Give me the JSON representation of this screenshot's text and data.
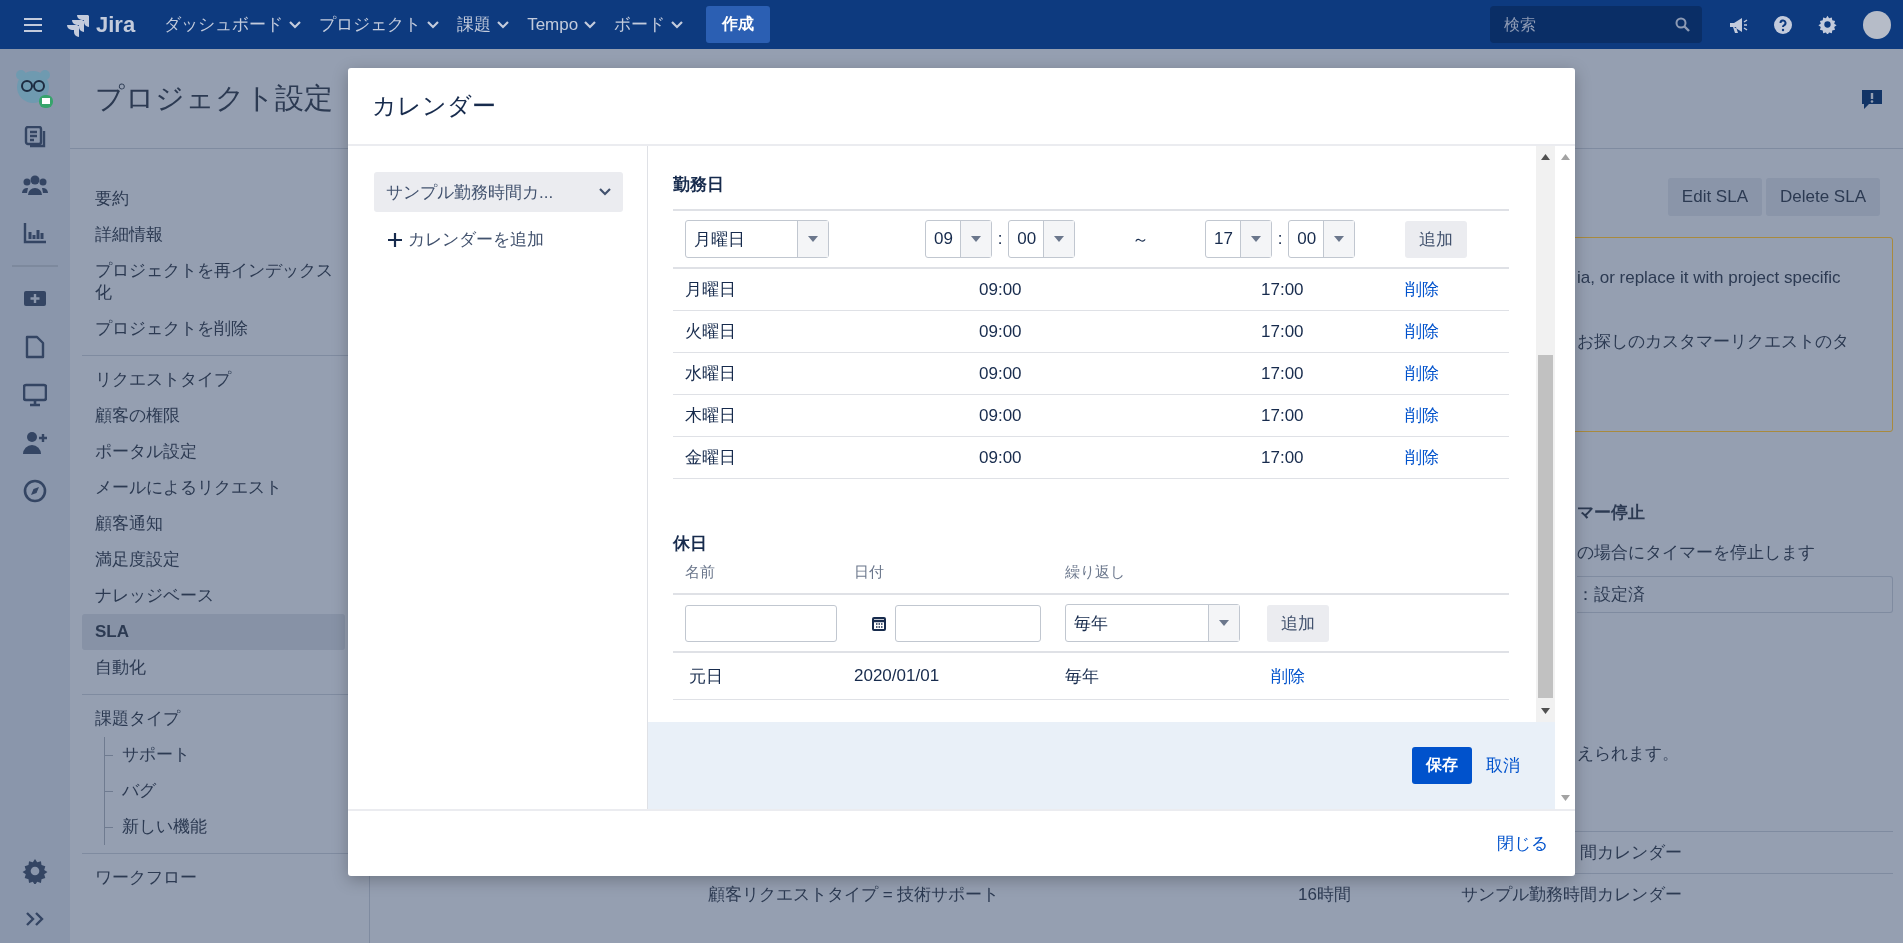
{
  "topbar": {
    "logo_text": "Jira",
    "nav": [
      {
        "label": "ダッシュボード",
        "dropdown": true
      },
      {
        "label": "プロジェクト",
        "dropdown": true
      },
      {
        "label": "課題",
        "dropdown": true
      },
      {
        "label": "Tempo",
        "dropdown": true
      },
      {
        "label": "ボード",
        "dropdown": true
      }
    ],
    "create_button": "作成",
    "search": {
      "placeholder": "検索"
    }
  },
  "page": {
    "title": "プロジェクト設定"
  },
  "sidebar": {
    "groups": [
      {
        "items": [
          {
            "label": "要約",
            "selected": false
          },
          {
            "label": "詳細情報",
            "selected": false
          },
          {
            "label": "プロジェクトを再インデックス化",
            "selected": false
          },
          {
            "label": "プロジェクトを削除",
            "selected": false
          }
        ]
      },
      {
        "items": [
          {
            "label": "リクエストタイプ",
            "selected": false
          },
          {
            "label": "顧客の権限",
            "selected": false
          },
          {
            "label": "ポータル設定",
            "selected": false
          },
          {
            "label": "メールによるリクエスト",
            "selected": false
          },
          {
            "label": "顧客通知",
            "selected": false
          },
          {
            "label": "満足度設定",
            "selected": false
          },
          {
            "label": "ナレッジベース",
            "selected": false
          },
          {
            "label": "SLA",
            "selected": true
          },
          {
            "label": "自動化",
            "selected": false
          }
        ]
      },
      {
        "items": [
          {
            "label": "課題タイプ",
            "selected": false,
            "children": [
              {
                "label": "サポート",
                "selected": false
              },
              {
                "label": "バグ",
                "selected": false
              },
              {
                "label": "新しい機能",
                "selected": false
              }
            ]
          }
        ]
      },
      {
        "items": [
          {
            "label": "ワークフロー",
            "selected": false
          }
        ]
      }
    ]
  },
  "main": {
    "buttons": [
      "Edit SLA",
      "Delete SLA"
    ],
    "notice": {
      "lines": [
        "ia, or replace it with project specific",
        "お探しのカスタマーリクエストのタ"
      ]
    },
    "timer_heading": "マー停止",
    "timer_text": "の場合にタイマーを停止します",
    "condition_field": "：設定済",
    "note": "えられます。",
    "table": {
      "rows": [
        {
          "column_3": "間カレンダー"
        },
        {
          "column_1": "顧客リクエストタイプ = 技術サポート",
          "column_2": "16時間",
          "column_3": "サンプル勤務時間カレンダー"
        }
      ]
    }
  },
  "modal": {
    "title": "カレンダー",
    "calendar_select": "サンプル勤務時間カ...",
    "add_calendar": "カレンダーを追加",
    "working_days": {
      "heading": "勤務日",
      "form": {
        "day": "月曜日",
        "start_hour": "09",
        "start_colon": ":",
        "start_minute": "00",
        "separator": "～",
        "end_hour": "17",
        "end_colon": ":",
        "end_minute": "00",
        "add_button": "追加"
      },
      "rows": [
        {
          "day": "月曜日",
          "start": "09:00",
          "end": "17:00",
          "action": "削除"
        },
        {
          "day": "火曜日",
          "start": "09:00",
          "end": "17:00",
          "action": "削除"
        },
        {
          "day": "水曜日",
          "start": "09:00",
          "end": "17:00",
          "action": "削除"
        },
        {
          "day": "木曜日",
          "start": "09:00",
          "end": "17:00",
          "action": "削除"
        },
        {
          "day": "金曜日",
          "start": "09:00",
          "end": "17:00",
          "action": "削除"
        }
      ]
    },
    "holidays": {
      "heading": "休日",
      "columns": [
        "名前",
        "日付",
        "繰り返し"
      ],
      "form": {
        "repeat": "毎年",
        "add_button": "追加"
      },
      "rows": [
        {
          "name": "元日",
          "date": "2020/01/01",
          "repeat": "毎年",
          "action": "削除"
        }
      ]
    },
    "actions": {
      "save": "保存",
      "cancel": "取消"
    },
    "close": "閉じる"
  }
}
